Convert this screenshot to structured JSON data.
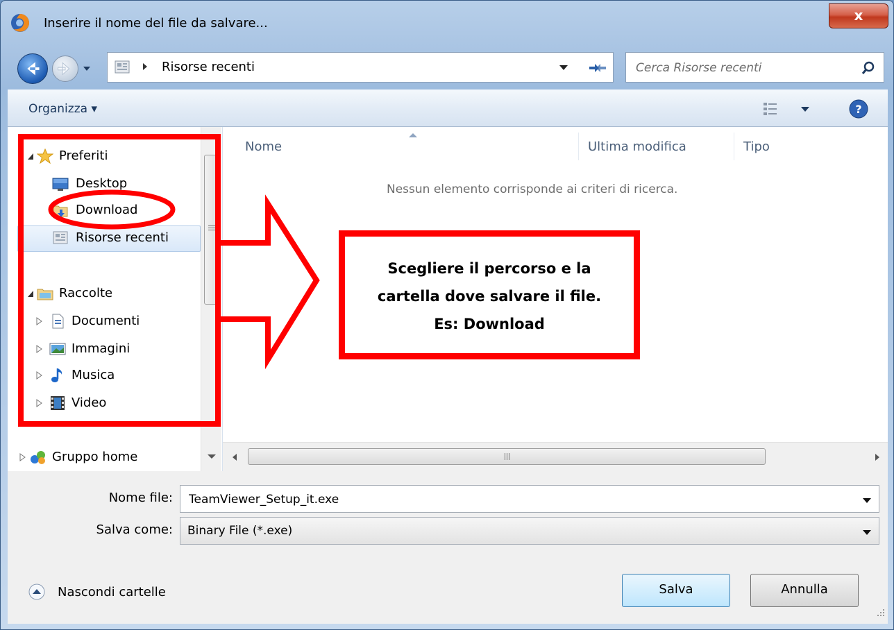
{
  "window": {
    "title": "Inserire il nome del file da salvare...",
    "close_label": "x"
  },
  "navigation": {
    "address_path": "Risorse recenti",
    "search_placeholder": "Cerca Risorse recenti"
  },
  "toolbar": {
    "organize_label": "Organizza ▾"
  },
  "sidebar": {
    "favorites_header": "Preferiti",
    "favorites": [
      {
        "label": "Desktop",
        "icon": "desktop-icon"
      },
      {
        "label": "Download",
        "icon": "download-folder-icon"
      },
      {
        "label": "Risorse recenti",
        "icon": "recent-places-icon",
        "selected": true
      }
    ],
    "libraries_header": "Raccolte",
    "libraries": [
      {
        "label": "Documenti",
        "icon": "documents-icon"
      },
      {
        "label": "Immagini",
        "icon": "pictures-icon"
      },
      {
        "label": "Musica",
        "icon": "music-icon"
      },
      {
        "label": "Video",
        "icon": "video-icon"
      }
    ],
    "homegroup": {
      "label": "Gruppo home",
      "icon": "homegroup-icon"
    }
  },
  "file_list": {
    "columns": [
      "Nome",
      "Ultima modifica",
      "Tipo"
    ],
    "empty_message": "Nessun elemento corrisponde ai criteri di ricerca."
  },
  "form": {
    "filename_label": "Nome file:",
    "filename_value": "TeamViewer_Setup_it.exe",
    "savetype_label": "Salva come:",
    "savetype_value": "Binary File (*.exe)"
  },
  "footer": {
    "hide_folders_label": "Nascondi cartelle",
    "save_label": "Salva",
    "cancel_label": "Annulla"
  },
  "annotation": {
    "callout_lines": [
      "Scegliere il percorso e la",
      "cartella dove salvare il file.",
      "Es: Download"
    ],
    "color": "#ff0000"
  }
}
